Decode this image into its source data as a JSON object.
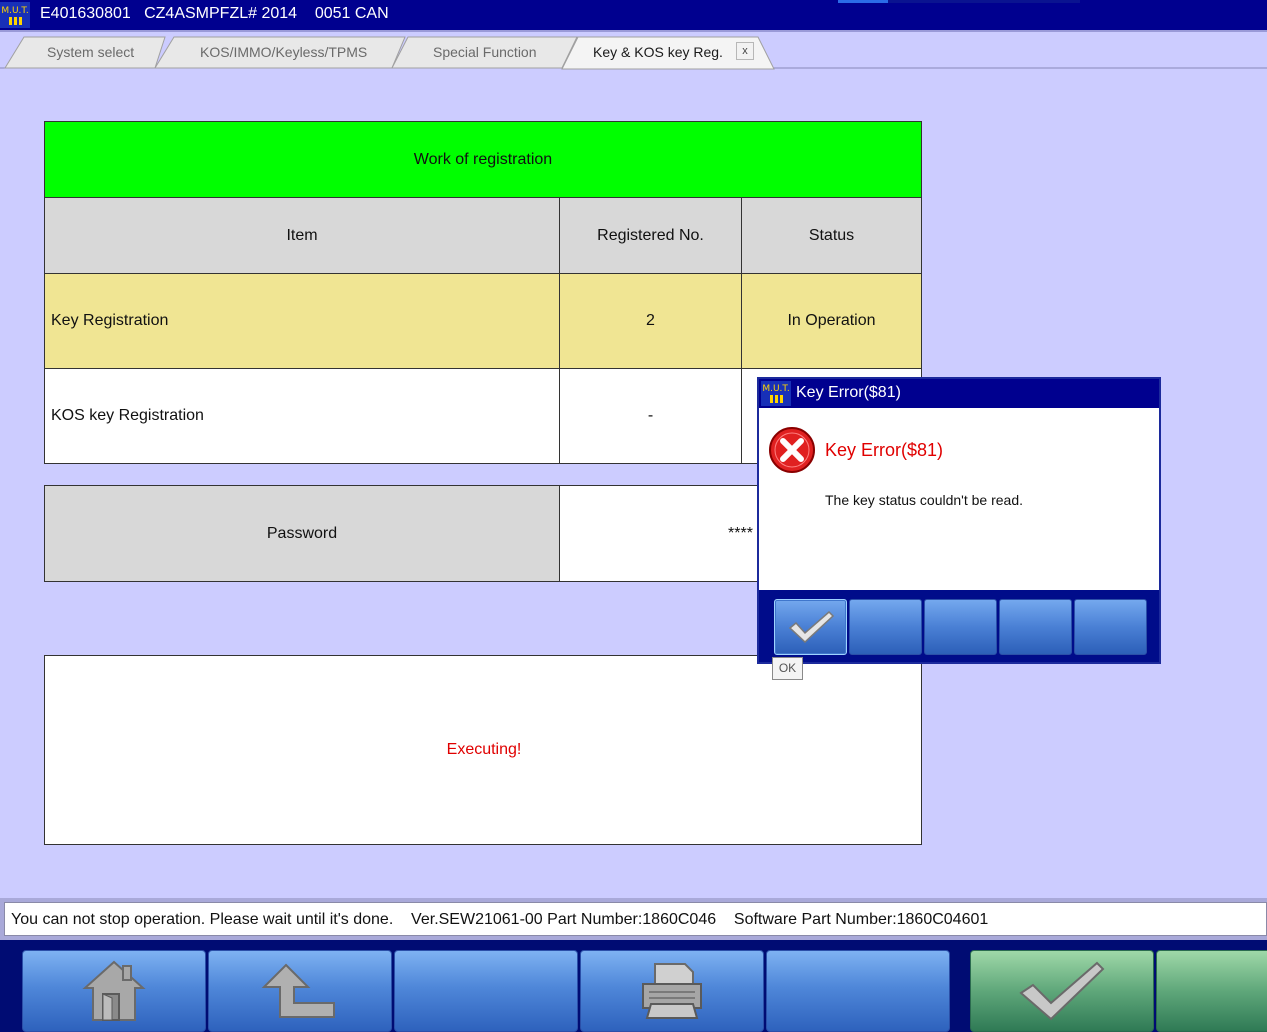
{
  "window": {
    "title": "E401630801   CZ4ASMPFZL# 2014    0051 CAN",
    "logo_icon": "mut3-logo-icon"
  },
  "tabs": [
    {
      "label": "System select"
    },
    {
      "label": "KOS/IMMO/Keyless/TPMS"
    },
    {
      "label": "Special Function"
    },
    {
      "label": "Key & KOS key Reg.",
      "active": true,
      "close_label": "x"
    }
  ],
  "registration": {
    "header": "Work of registration",
    "columns": {
      "item": "Item",
      "registered_no": "Registered No.",
      "status": "Status"
    },
    "rows": [
      {
        "item": "Key Registration",
        "registered_no": "2",
        "status": "In Operation"
      },
      {
        "item": "KOS key Registration",
        "registered_no": "-",
        "status": ""
      }
    ]
  },
  "password": {
    "label": "Password",
    "value": "****"
  },
  "execution": {
    "message": "Executing!"
  },
  "status_bar": {
    "text": "You can not stop operation. Please wait until it's done.    Ver.SEW21061-00 Part Number:1860C046    Software Part Number:1860C04601"
  },
  "toolbar": {
    "buttons": [
      {
        "icon": "home-icon"
      },
      {
        "icon": "back-arrow-icon"
      },
      {
        "icon": ""
      },
      {
        "icon": "printer-icon"
      },
      {
        "icon": ""
      },
      {
        "icon": "checkmark-icon"
      },
      {
        "icon": ""
      }
    ]
  },
  "dialog": {
    "title": "Key Error($81)",
    "heading": "Key Error($81)",
    "message": "The key status couldn't be read.",
    "ok_tooltip": "OK",
    "icon": "error-x-icon"
  },
  "colors": {
    "title_bar": "#00008f",
    "workspace": "#ccccff",
    "header_green": "#00ff00",
    "row_highlight": "#f0e593",
    "error_red": "#e00000"
  }
}
